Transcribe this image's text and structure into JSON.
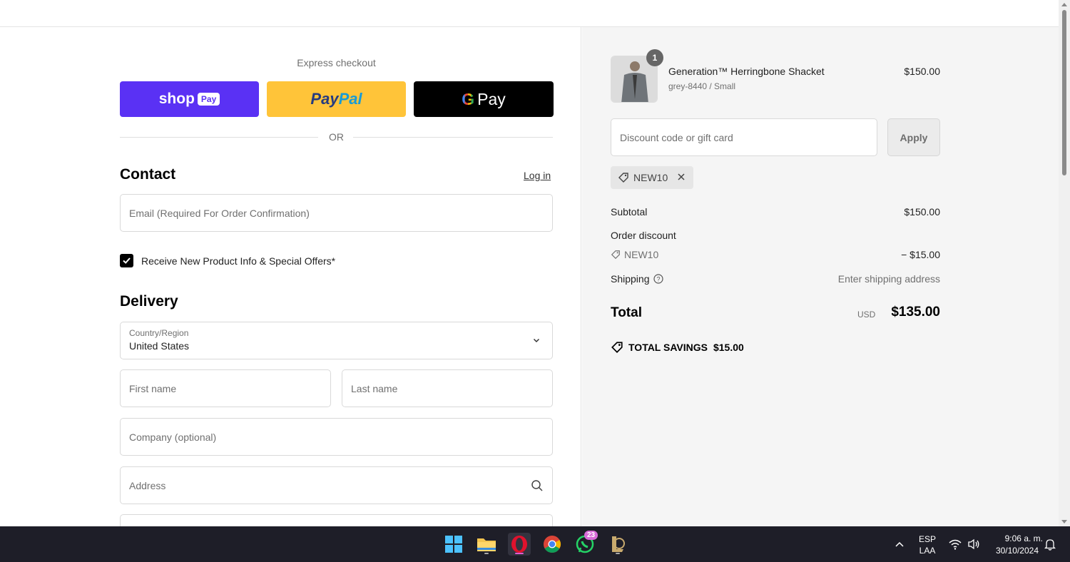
{
  "express": {
    "label": "Express checkout",
    "shop_pay_text": "shop",
    "shop_pay_pill": "Pay",
    "paypal_pay": "Pay",
    "paypal_pal": "Pal",
    "gpay_g": "G",
    "gpay_text": "Pay",
    "or_text": "OR"
  },
  "contact": {
    "title": "Contact",
    "login_label": "Log in",
    "email_placeholder": "Email (Required For Order Confirmation)",
    "newsletter_label": "Receive New Product Info & Special Offers*",
    "newsletter_checked": true
  },
  "delivery": {
    "title": "Delivery",
    "country_label": "Country/Region",
    "country_value": "United States",
    "first_name_placeholder": "First name",
    "last_name_placeholder": "Last name",
    "company_placeholder": "Company (optional)",
    "address_placeholder": "Address"
  },
  "summary": {
    "product": {
      "quantity": "1",
      "name": "Generation™ Herringbone Shacket",
      "variant": "grey-8440 / Small",
      "price": "$150.00"
    },
    "discount_placeholder": "Discount code or gift card",
    "apply_label": "Apply",
    "applied_code": "NEW10",
    "subtotal_label": "Subtotal",
    "subtotal_value": "$150.00",
    "order_discount_label": "Order discount",
    "discount_code": "NEW10",
    "discount_value": "− $15.00",
    "shipping_label": "Shipping",
    "shipping_value": "Enter shipping address",
    "total_label": "Total",
    "total_currency": "USD",
    "total_value": "$135.00",
    "savings_label": "TOTAL SAVINGS",
    "savings_value": "$15.00"
  },
  "taskbar": {
    "whatsapp_badge": "23",
    "lang_top": "ESP",
    "lang_bottom": "LAA",
    "time": "9:06 a. m.",
    "date": "30/10/2024"
  },
  "colors": {
    "shop_pay": "#5a31f4",
    "paypal": "#ffc439",
    "gpay": "#000000",
    "summary_bg": "#f5f5f5"
  }
}
